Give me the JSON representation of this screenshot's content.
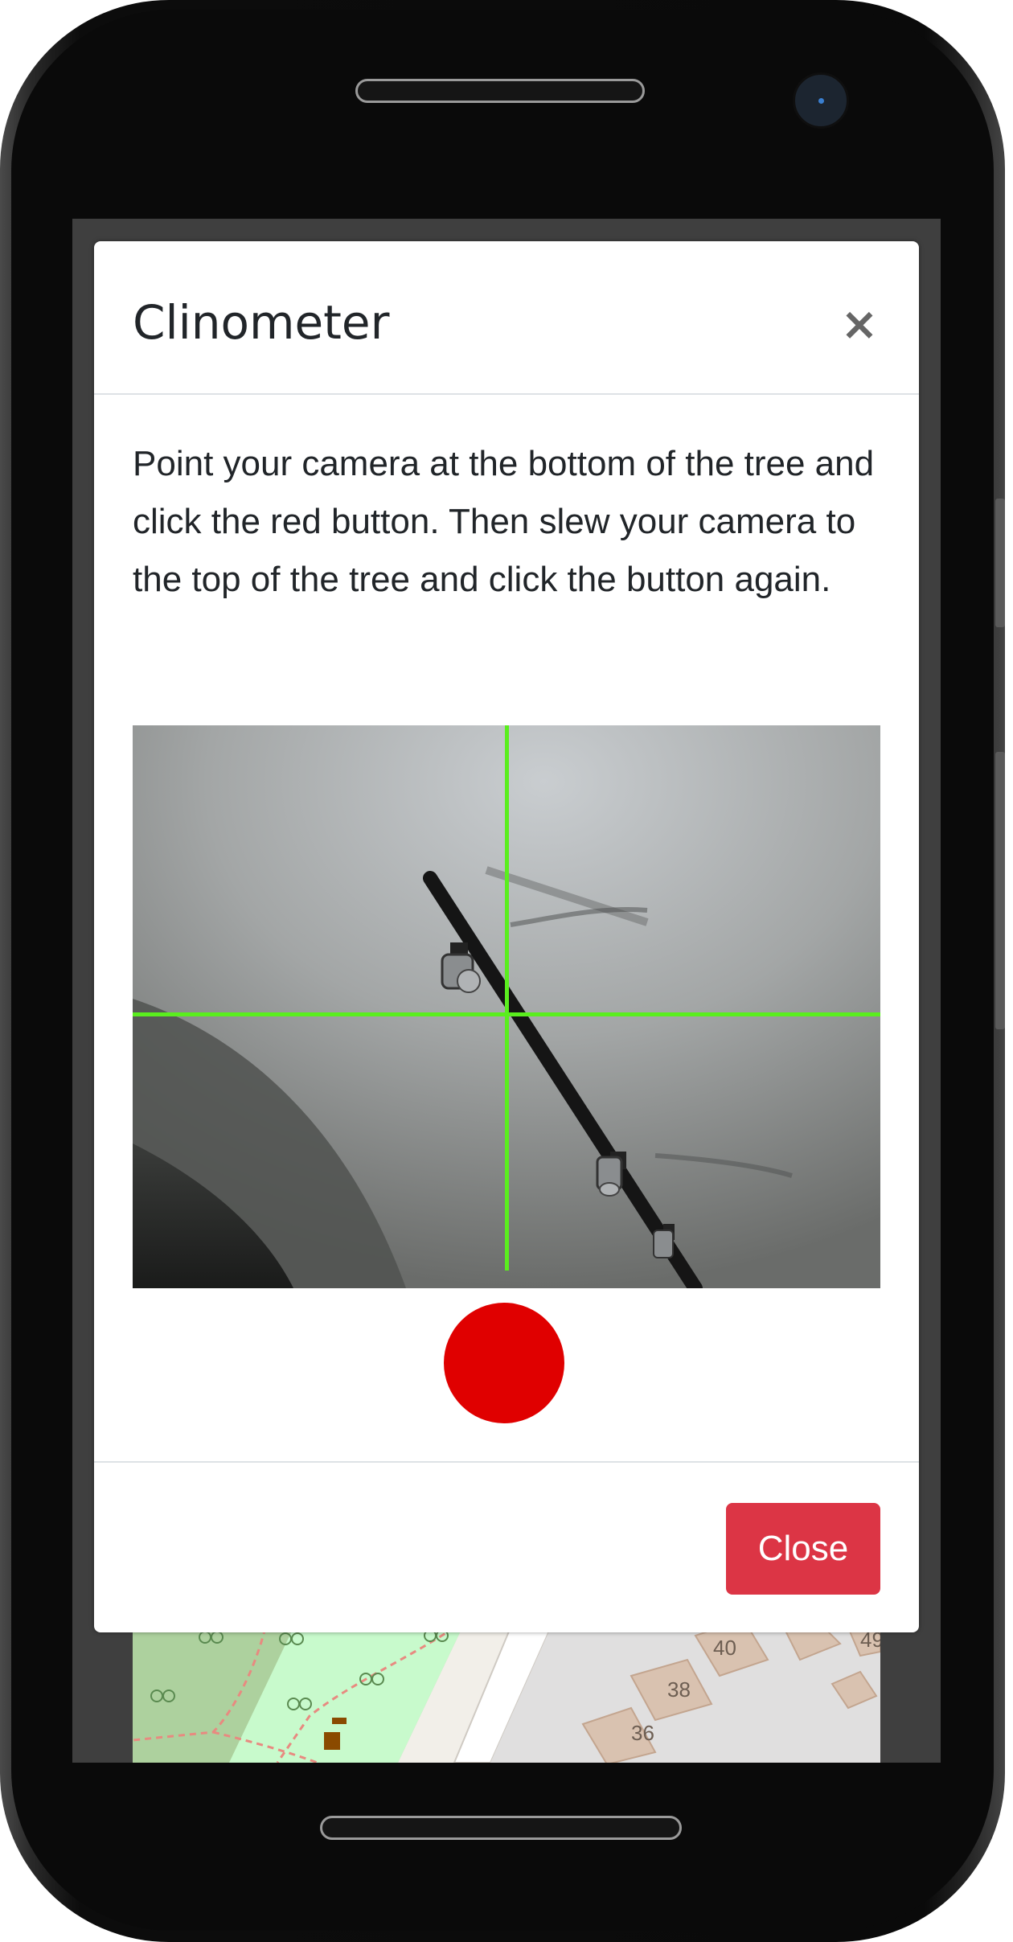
{
  "modal": {
    "title": "Clinometer",
    "close_icon": "×",
    "instructions": "Point your camera at the bottom of the tree and click the red button. Then slew your camera to the top of the tree and click the button again.",
    "capture_button_color": "#e00000",
    "crosshair_color": "#5aee1e",
    "close_button_label": "Close",
    "close_button_color": "#dc3545"
  },
  "map": {
    "house_numbers": [
      "40",
      "38",
      "36",
      "49"
    ]
  }
}
